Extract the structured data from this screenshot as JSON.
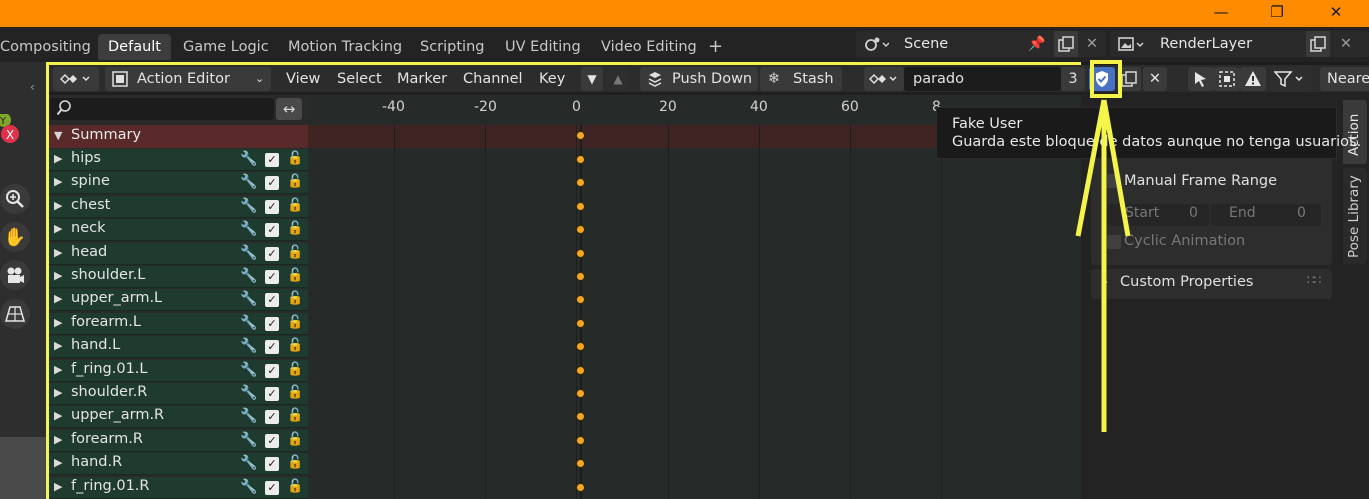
{
  "window": {
    "minimize": "—",
    "maximize": "❐",
    "close": "✕"
  },
  "workspaces": {
    "tabs": [
      "Compositing",
      "Default",
      "Game Logic",
      "Motion Tracking",
      "Scripting",
      "UV Editing",
      "Video Editing"
    ],
    "active": "Default",
    "add": "+"
  },
  "scene": {
    "name": "Scene",
    "render_layer": "RenderLayer"
  },
  "header": {
    "editor_type": "Action Editor",
    "menus": [
      "View",
      "Select",
      "Marker",
      "Channel",
      "Key"
    ],
    "push_down": "Push Down",
    "stash": "Stash",
    "action_name": "parado",
    "users": "3",
    "interpolation": "Neare"
  },
  "channels": {
    "search_placeholder": "",
    "summary": "Summary",
    "bones": [
      "hips",
      "spine",
      "chest",
      "neck",
      "head",
      "shoulder.L",
      "upper_arm.L",
      "forearm.L",
      "hand.L",
      "f_ring.01.L",
      "shoulder.R",
      "upper_arm.R",
      "forearm.R",
      "hand.R",
      "f_ring.01.R"
    ]
  },
  "timeline": {
    "ticks": [
      "-40",
      "-20",
      "0",
      "20",
      "40",
      "60",
      "8"
    ]
  },
  "sidebar": {
    "tabs": [
      "Action",
      "Pose Library"
    ],
    "manual_frame_range": "Manual Frame Range",
    "start_label": "Start",
    "start_value": "0",
    "end_label": "End",
    "end_value": "0",
    "cyclic": "Cyclic Animation",
    "custom_properties": "Custom Properties"
  },
  "tooltip": {
    "title": "Fake User",
    "description": "Guarda este bloque de datos aunque no tenga usuarios."
  },
  "colors": {
    "title_bar": "#ff8c00",
    "annotation": "#f4f44a",
    "keyframe": "#f5a623",
    "channel_bg": "#1f3b2f"
  }
}
